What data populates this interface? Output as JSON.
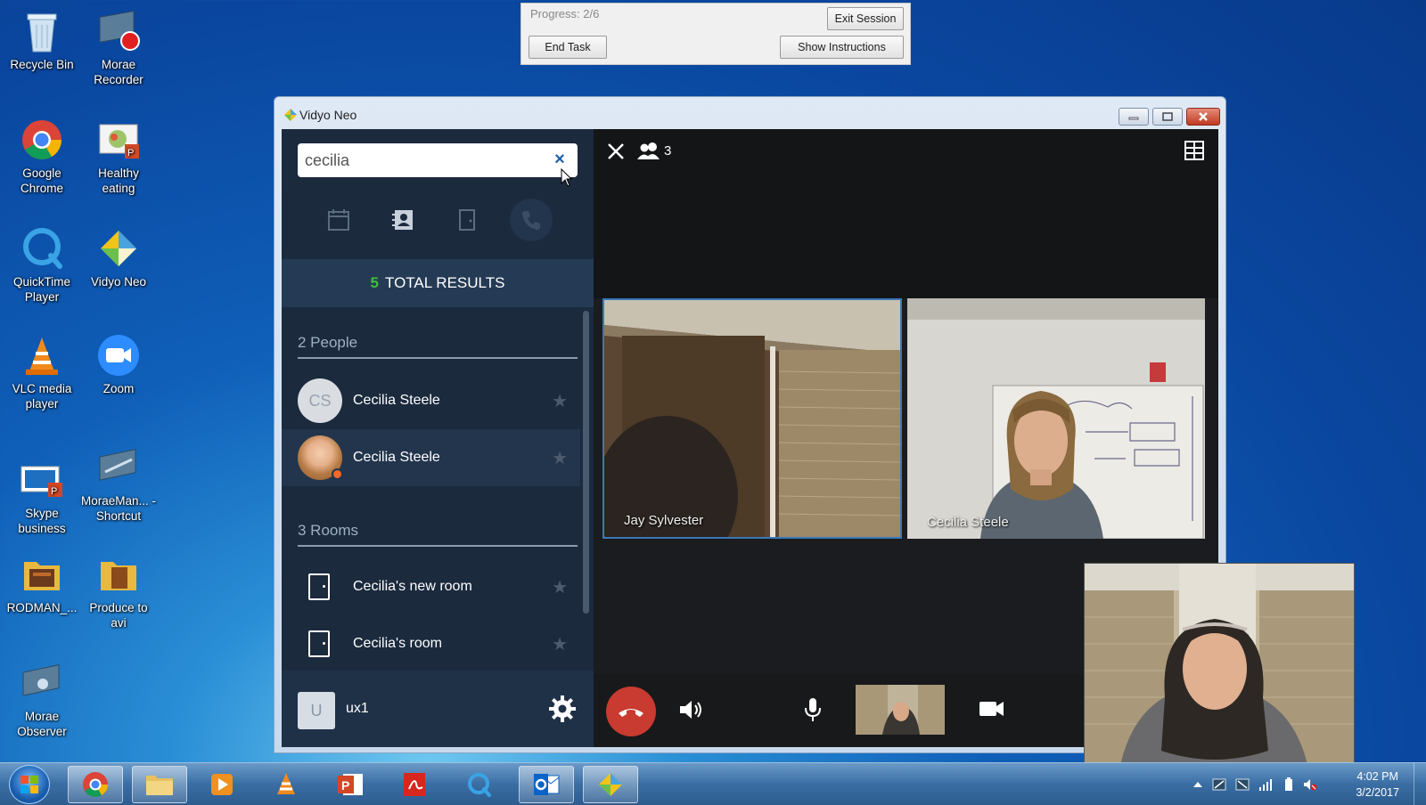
{
  "desktop": {
    "icons": [
      {
        "label": "Recycle Bin"
      },
      {
        "label": "Morae Recorder"
      },
      {
        "label": "Google Chrome"
      },
      {
        "label": "Healthy eating"
      },
      {
        "label": "QuickTime Player"
      },
      {
        "label": "Vidyo Neo"
      },
      {
        "label": "VLC media player"
      },
      {
        "label": "Zoom"
      },
      {
        "label": "Skype business"
      },
      {
        "label": "MoraeMan... - Shortcut"
      },
      {
        "label": "RODMAN_..."
      },
      {
        "label": "Produce to avi"
      },
      {
        "label": "Morae Observer"
      }
    ]
  },
  "progress_panel": {
    "progress_text": "Progress: 2/6",
    "exit_label": "Exit Session",
    "end_task_label": "End Task",
    "show_instructions_label": "Show Instructions"
  },
  "window": {
    "title": "Vidyo Neo"
  },
  "search": {
    "value": "cecilia",
    "clear_glyph": "×"
  },
  "results": {
    "count": "5",
    "label": "TOTAL RESULTS",
    "people_header": "2 People",
    "rooms_header": "3 Rooms",
    "people": [
      {
        "initials": "CS",
        "name": "Cecilia Steele"
      },
      {
        "initials": "",
        "name": "Cecilia Steele"
      }
    ],
    "rooms": [
      {
        "name": "Cecilia's new room"
      },
      {
        "name": "Cecilia's room"
      }
    ]
  },
  "user": {
    "initial": "U",
    "name": "ux1"
  },
  "call": {
    "participant_count": "3",
    "participants": [
      {
        "name": "Jay Sylvester"
      },
      {
        "name": "Cecilia Steele"
      }
    ]
  },
  "taskbar": {
    "time": "4:02 PM",
    "date": "3/2/2017"
  }
}
